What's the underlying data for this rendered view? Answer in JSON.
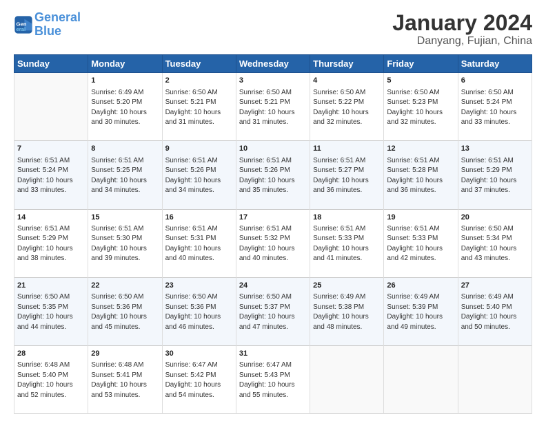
{
  "header": {
    "logo_line1": "General",
    "logo_line2": "Blue",
    "title": "January 2024",
    "subtitle": "Danyang, Fujian, China"
  },
  "columns": [
    "Sunday",
    "Monday",
    "Tuesday",
    "Wednesday",
    "Thursday",
    "Friday",
    "Saturday"
  ],
  "weeks": [
    [
      {
        "day": "",
        "info": ""
      },
      {
        "day": "1",
        "info": "Sunrise: 6:49 AM\nSunset: 5:20 PM\nDaylight: 10 hours\nand 30 minutes."
      },
      {
        "day": "2",
        "info": "Sunrise: 6:50 AM\nSunset: 5:21 PM\nDaylight: 10 hours\nand 31 minutes."
      },
      {
        "day": "3",
        "info": "Sunrise: 6:50 AM\nSunset: 5:21 PM\nDaylight: 10 hours\nand 31 minutes."
      },
      {
        "day": "4",
        "info": "Sunrise: 6:50 AM\nSunset: 5:22 PM\nDaylight: 10 hours\nand 32 minutes."
      },
      {
        "day": "5",
        "info": "Sunrise: 6:50 AM\nSunset: 5:23 PM\nDaylight: 10 hours\nand 32 minutes."
      },
      {
        "day": "6",
        "info": "Sunrise: 6:50 AM\nSunset: 5:24 PM\nDaylight: 10 hours\nand 33 minutes."
      }
    ],
    [
      {
        "day": "7",
        "info": "Sunrise: 6:51 AM\nSunset: 5:24 PM\nDaylight: 10 hours\nand 33 minutes."
      },
      {
        "day": "8",
        "info": "Sunrise: 6:51 AM\nSunset: 5:25 PM\nDaylight: 10 hours\nand 34 minutes."
      },
      {
        "day": "9",
        "info": "Sunrise: 6:51 AM\nSunset: 5:26 PM\nDaylight: 10 hours\nand 34 minutes."
      },
      {
        "day": "10",
        "info": "Sunrise: 6:51 AM\nSunset: 5:26 PM\nDaylight: 10 hours\nand 35 minutes."
      },
      {
        "day": "11",
        "info": "Sunrise: 6:51 AM\nSunset: 5:27 PM\nDaylight: 10 hours\nand 36 minutes."
      },
      {
        "day": "12",
        "info": "Sunrise: 6:51 AM\nSunset: 5:28 PM\nDaylight: 10 hours\nand 36 minutes."
      },
      {
        "day": "13",
        "info": "Sunrise: 6:51 AM\nSunset: 5:29 PM\nDaylight: 10 hours\nand 37 minutes."
      }
    ],
    [
      {
        "day": "14",
        "info": "Sunrise: 6:51 AM\nSunset: 5:29 PM\nDaylight: 10 hours\nand 38 minutes."
      },
      {
        "day": "15",
        "info": "Sunrise: 6:51 AM\nSunset: 5:30 PM\nDaylight: 10 hours\nand 39 minutes."
      },
      {
        "day": "16",
        "info": "Sunrise: 6:51 AM\nSunset: 5:31 PM\nDaylight: 10 hours\nand 40 minutes."
      },
      {
        "day": "17",
        "info": "Sunrise: 6:51 AM\nSunset: 5:32 PM\nDaylight: 10 hours\nand 40 minutes."
      },
      {
        "day": "18",
        "info": "Sunrise: 6:51 AM\nSunset: 5:33 PM\nDaylight: 10 hours\nand 41 minutes."
      },
      {
        "day": "19",
        "info": "Sunrise: 6:51 AM\nSunset: 5:33 PM\nDaylight: 10 hours\nand 42 minutes."
      },
      {
        "day": "20",
        "info": "Sunrise: 6:50 AM\nSunset: 5:34 PM\nDaylight: 10 hours\nand 43 minutes."
      }
    ],
    [
      {
        "day": "21",
        "info": "Sunrise: 6:50 AM\nSunset: 5:35 PM\nDaylight: 10 hours\nand 44 minutes."
      },
      {
        "day": "22",
        "info": "Sunrise: 6:50 AM\nSunset: 5:36 PM\nDaylight: 10 hours\nand 45 minutes."
      },
      {
        "day": "23",
        "info": "Sunrise: 6:50 AM\nSunset: 5:36 PM\nDaylight: 10 hours\nand 46 minutes."
      },
      {
        "day": "24",
        "info": "Sunrise: 6:50 AM\nSunset: 5:37 PM\nDaylight: 10 hours\nand 47 minutes."
      },
      {
        "day": "25",
        "info": "Sunrise: 6:49 AM\nSunset: 5:38 PM\nDaylight: 10 hours\nand 48 minutes."
      },
      {
        "day": "26",
        "info": "Sunrise: 6:49 AM\nSunset: 5:39 PM\nDaylight: 10 hours\nand 49 minutes."
      },
      {
        "day": "27",
        "info": "Sunrise: 6:49 AM\nSunset: 5:40 PM\nDaylight: 10 hours\nand 50 minutes."
      }
    ],
    [
      {
        "day": "28",
        "info": "Sunrise: 6:48 AM\nSunset: 5:40 PM\nDaylight: 10 hours\nand 52 minutes."
      },
      {
        "day": "29",
        "info": "Sunrise: 6:48 AM\nSunset: 5:41 PM\nDaylight: 10 hours\nand 53 minutes."
      },
      {
        "day": "30",
        "info": "Sunrise: 6:47 AM\nSunset: 5:42 PM\nDaylight: 10 hours\nand 54 minutes."
      },
      {
        "day": "31",
        "info": "Sunrise: 6:47 AM\nSunset: 5:43 PM\nDaylight: 10 hours\nand 55 minutes."
      },
      {
        "day": "",
        "info": ""
      },
      {
        "day": "",
        "info": ""
      },
      {
        "day": "",
        "info": ""
      }
    ]
  ]
}
